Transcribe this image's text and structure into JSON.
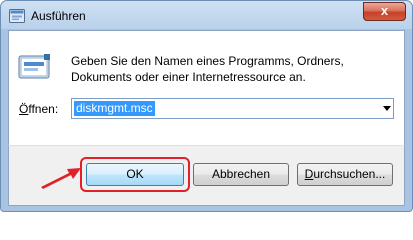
{
  "window": {
    "title": "Ausführen",
    "close_label": "x"
  },
  "message": {
    "line1": "Geben Sie den Namen eines Programms, Ordners,",
    "line2": "Dokuments oder einer Internetressource an."
  },
  "open": {
    "label_prefix": "Ö",
    "label_rest": "ffnen:",
    "value": "diskmgmt.msc"
  },
  "buttons": {
    "ok": "OK",
    "cancel": "Abbrechen",
    "browse_prefix": "D",
    "browse_rest": "urchsuchen..."
  },
  "colors": {
    "highlight": "#e0202a",
    "selection": "#3399ff",
    "close_button": "#c8402a"
  },
  "icons": [
    "run-window-icon",
    "close-icon",
    "run-app-icon",
    "dropdown-arrow-icon",
    "annotation-arrow-icon"
  ]
}
